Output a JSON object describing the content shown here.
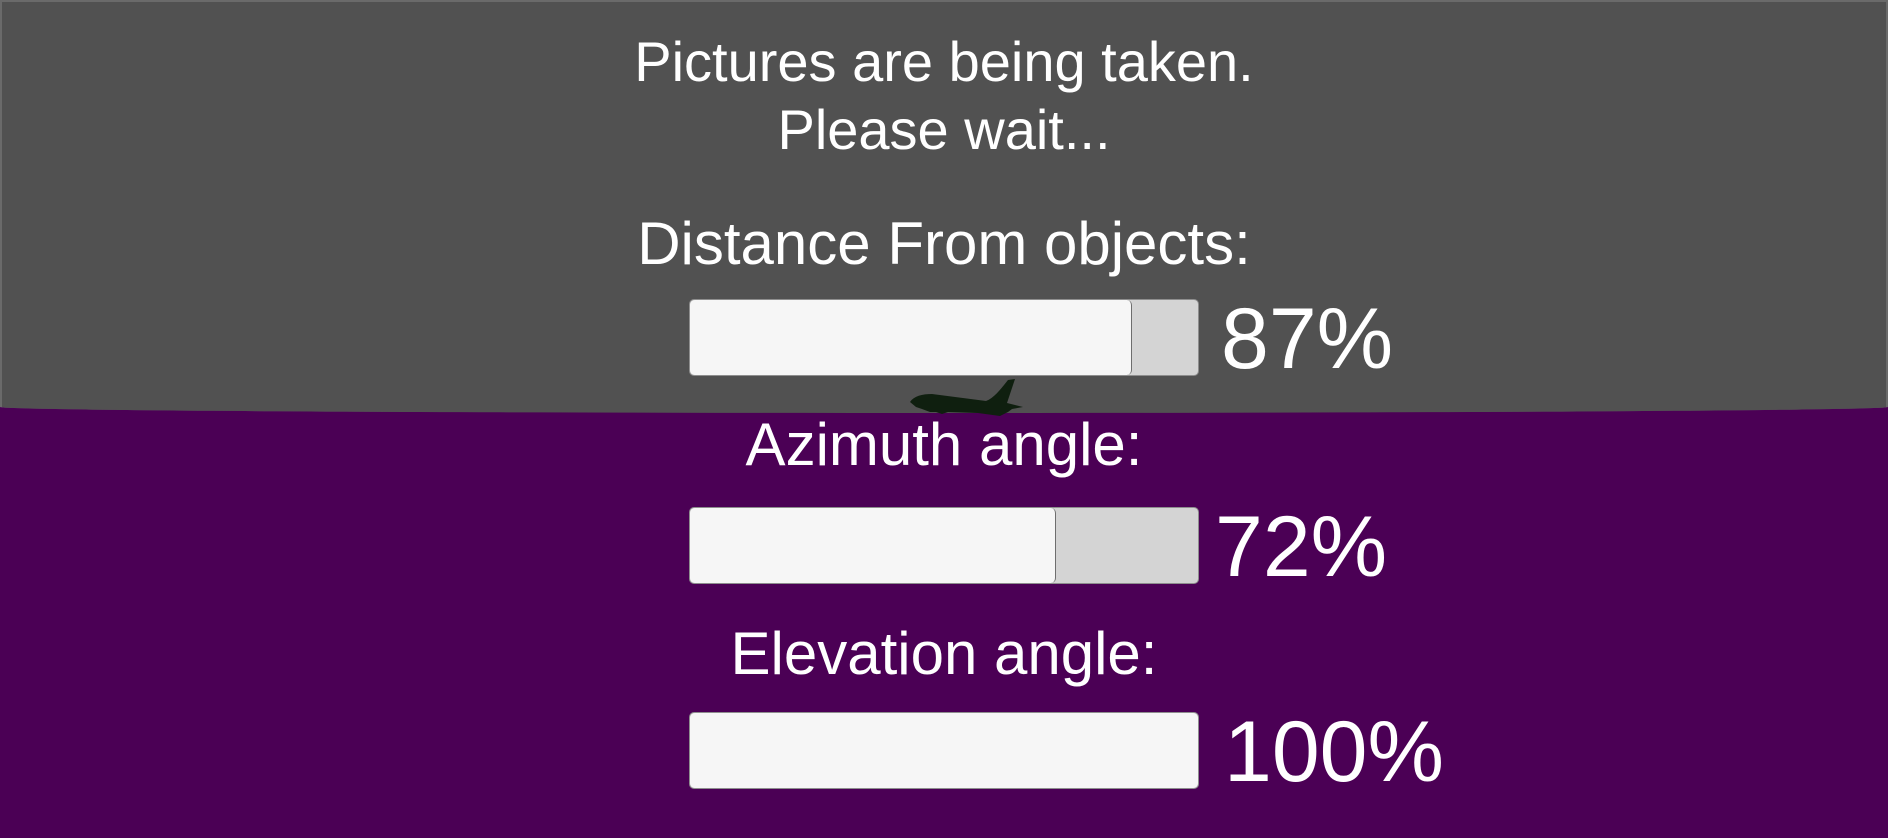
{
  "status": {
    "line1": "Pictures are being taken.",
    "line2": "Please wait..."
  },
  "progress_bars": [
    {
      "id": "distance",
      "label": "Distance From objects:",
      "percent_text": "87%",
      "fill": 0.87
    },
    {
      "id": "azimuth",
      "label": "Azimuth angle:",
      "percent_text": "72%",
      "fill": 0.72
    },
    {
      "id": "elevation",
      "label": "Elevation angle:",
      "percent_text": "100%",
      "fill": 1.0
    }
  ],
  "colors": {
    "sky": "#515151",
    "ground": "#4b0055",
    "bar_track": "#d4d4d4",
    "bar_fill": "#f6f6f6",
    "text": "#ffffff",
    "airplane": "#0f1f0f"
  },
  "icons": {
    "scene_object": "airplane-icon"
  }
}
